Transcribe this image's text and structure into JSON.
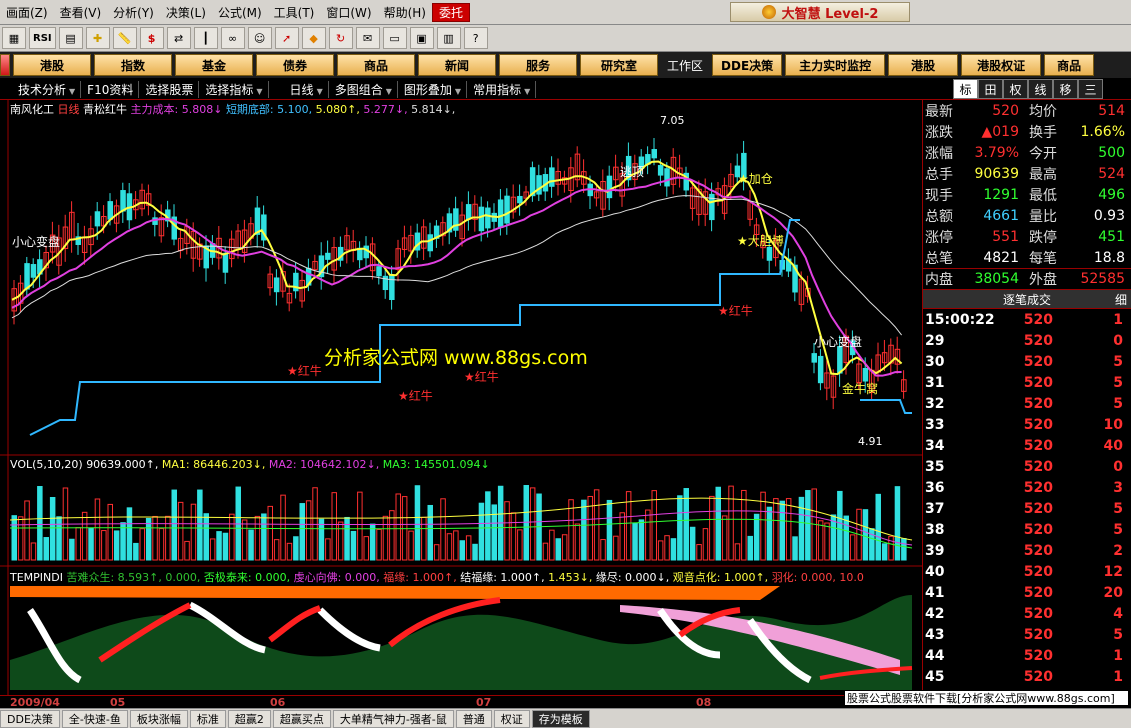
{
  "menu": {
    "items": [
      "画面(Z)",
      "查看(V)",
      "分析(Y)",
      "决策(L)",
      "公式(M)",
      "工具(T)",
      "窗口(W)",
      "帮助(H)",
      "委托"
    ],
    "brand": "大智慧 Level-2"
  },
  "toolbar": {
    "rsi": "RSI"
  },
  "nav": {
    "buttons": [
      "港股",
      "指数",
      "基金",
      "债券",
      "商品",
      "新闻",
      "服务",
      "研究室"
    ],
    "workspace": "工作区",
    "right_buttons": [
      "DDE决策",
      "主力实时监控",
      "港股",
      "港股权证",
      "商品"
    ]
  },
  "subbar": {
    "items": [
      "技术分析",
      "F10资料",
      "选择股票",
      "选择指标",
      "日线",
      "多图组合",
      "图形叠加",
      "常用指标"
    ],
    "right_tabs": [
      "标",
      "田",
      "权",
      "线",
      "移",
      "三"
    ]
  },
  "chart_header": {
    "stock": "南风化工",
    "period": "日线",
    "indicator": "青松红牛",
    "cost_label": "主力成本:",
    "cost_value": "5.808↓",
    "bottom_label": "短期底部:",
    "bottom_value": "5.100,",
    "v3": "5.080↑,",
    "v4": "5.277↓,",
    "v5": "5.814↓,"
  },
  "annotations": {
    "high": "7.05",
    "low": "4.91",
    "careful": "小心变盘",
    "careful2": "小心变盘",
    "escape": "逃顶",
    "redbull": "★红牛",
    "bull2": "★加仓",
    "bull3": "★大胆博",
    "redbull2": "★红牛",
    "goldnest": "金牛窝",
    "watermark": "分析家公式网 www.88gs.com"
  },
  "vol_header": {
    "title": "VOL(5,10,20)",
    "v": "90639.000↑,",
    "ma1_label": "MA1:",
    "ma1": "86446.203↓,",
    "ma2_label": "MA2:",
    "ma2": "104642.102↓,",
    "ma3_label": "MA3:",
    "ma3": "145501.094↓"
  },
  "temp_header": {
    "name": "TEMPINDI",
    "a": "苦难众生: 8.593↑, 0.000,",
    "b": "否极泰来: 0.000,",
    "c": "虔心向佛: 0.000,",
    "d": "福缘: 1.000↑,",
    "e": "结福缘: 1.000↑,",
    "f": "1.453↓,",
    "g": "缘尽: 0.000↓,",
    "h": "观音点化: 1.000↑,",
    "i": "羽化: 0.000, 10.0"
  },
  "dates": [
    "2009/04",
    "05",
    "06",
    "07",
    "08"
  ],
  "quote": {
    "rows": [
      {
        "l1": "最新",
        "v1": "520",
        "c1": "#ff3030",
        "l2": "均价",
        "v2": "514",
        "c2": "#ff3030"
      },
      {
        "l1": "涨跌",
        "v1": "▲019",
        "c1": "#ff3030",
        "l2": "换手",
        "v2": "1.66%",
        "c2": "#ffff40"
      },
      {
        "l1": "涨幅",
        "v1": "3.79%",
        "c1": "#ff3030",
        "l2": "今开",
        "v2": "500",
        "c2": "#30ff30"
      },
      {
        "l1": "总手",
        "v1": "90639",
        "c1": "#ffff40",
        "l2": "最高",
        "v2": "524",
        "c2": "#ff3030"
      },
      {
        "l1": "现手",
        "v1": "1291",
        "c1": "#30ff30",
        "l2": "最低",
        "v2": "496",
        "c2": "#30ff30"
      },
      {
        "l1": "总额",
        "v1": "4661",
        "c1": "#40d0ff",
        "l2": "量比",
        "v2": "0.93",
        "c2": "#ffffff"
      },
      {
        "l1": "涨停",
        "v1": "551",
        "c1": "#ff3030",
        "l2": "跌停",
        "v2": "451",
        "c2": "#30ff30"
      },
      {
        "l1": "总笔",
        "v1": "4821",
        "c1": "#ffffff",
        "l2": "每笔",
        "v2": "18.8",
        "c2": "#ffffff"
      },
      {
        "l1": "内盘",
        "v1": "38054",
        "c1": "#30ff30",
        "l2": "外盘",
        "v2": "52585",
        "c2": "#ff3030"
      }
    ]
  },
  "ticks": {
    "title": "逐笔成交",
    "detail": "细",
    "rows": [
      {
        "t": "15:00:22",
        "p": "520",
        "v": "1"
      },
      {
        "t": "29",
        "p": "520",
        "v": "0"
      },
      {
        "t": "30",
        "p": "520",
        "v": "5"
      },
      {
        "t": "31",
        "p": "520",
        "v": "5"
      },
      {
        "t": "32",
        "p": "520",
        "v": "5"
      },
      {
        "t": "33",
        "p": "520",
        "v": "10"
      },
      {
        "t": "34",
        "p": "520",
        "v": "40"
      },
      {
        "t": "35",
        "p": "520",
        "v": "0"
      },
      {
        "t": "36",
        "p": "520",
        "v": "3"
      },
      {
        "t": "37",
        "p": "520",
        "v": "5"
      },
      {
        "t": "38",
        "p": "520",
        "v": "5"
      },
      {
        "t": "39",
        "p": "520",
        "v": "2"
      },
      {
        "t": "40",
        "p": "520",
        "v": "12"
      },
      {
        "t": "41",
        "p": "520",
        "v": "20"
      },
      {
        "t": "42",
        "p": "520",
        "v": "4"
      },
      {
        "t": "43",
        "p": "520",
        "v": "5"
      },
      {
        "t": "44",
        "p": "520",
        "v": "1"
      },
      {
        "t": "45",
        "p": "520",
        "v": "1"
      }
    ]
  },
  "ad": "股票公式股票软件下载[分析家公式网www.88gs.com]",
  "bottom": [
    "DDE决策",
    "全-快速-鱼",
    "板块涨幅",
    "标准",
    "超赢2",
    "超赢买点",
    "大单精气神力-强者-鼠",
    "普通",
    "权证",
    "存为模板"
  ]
}
